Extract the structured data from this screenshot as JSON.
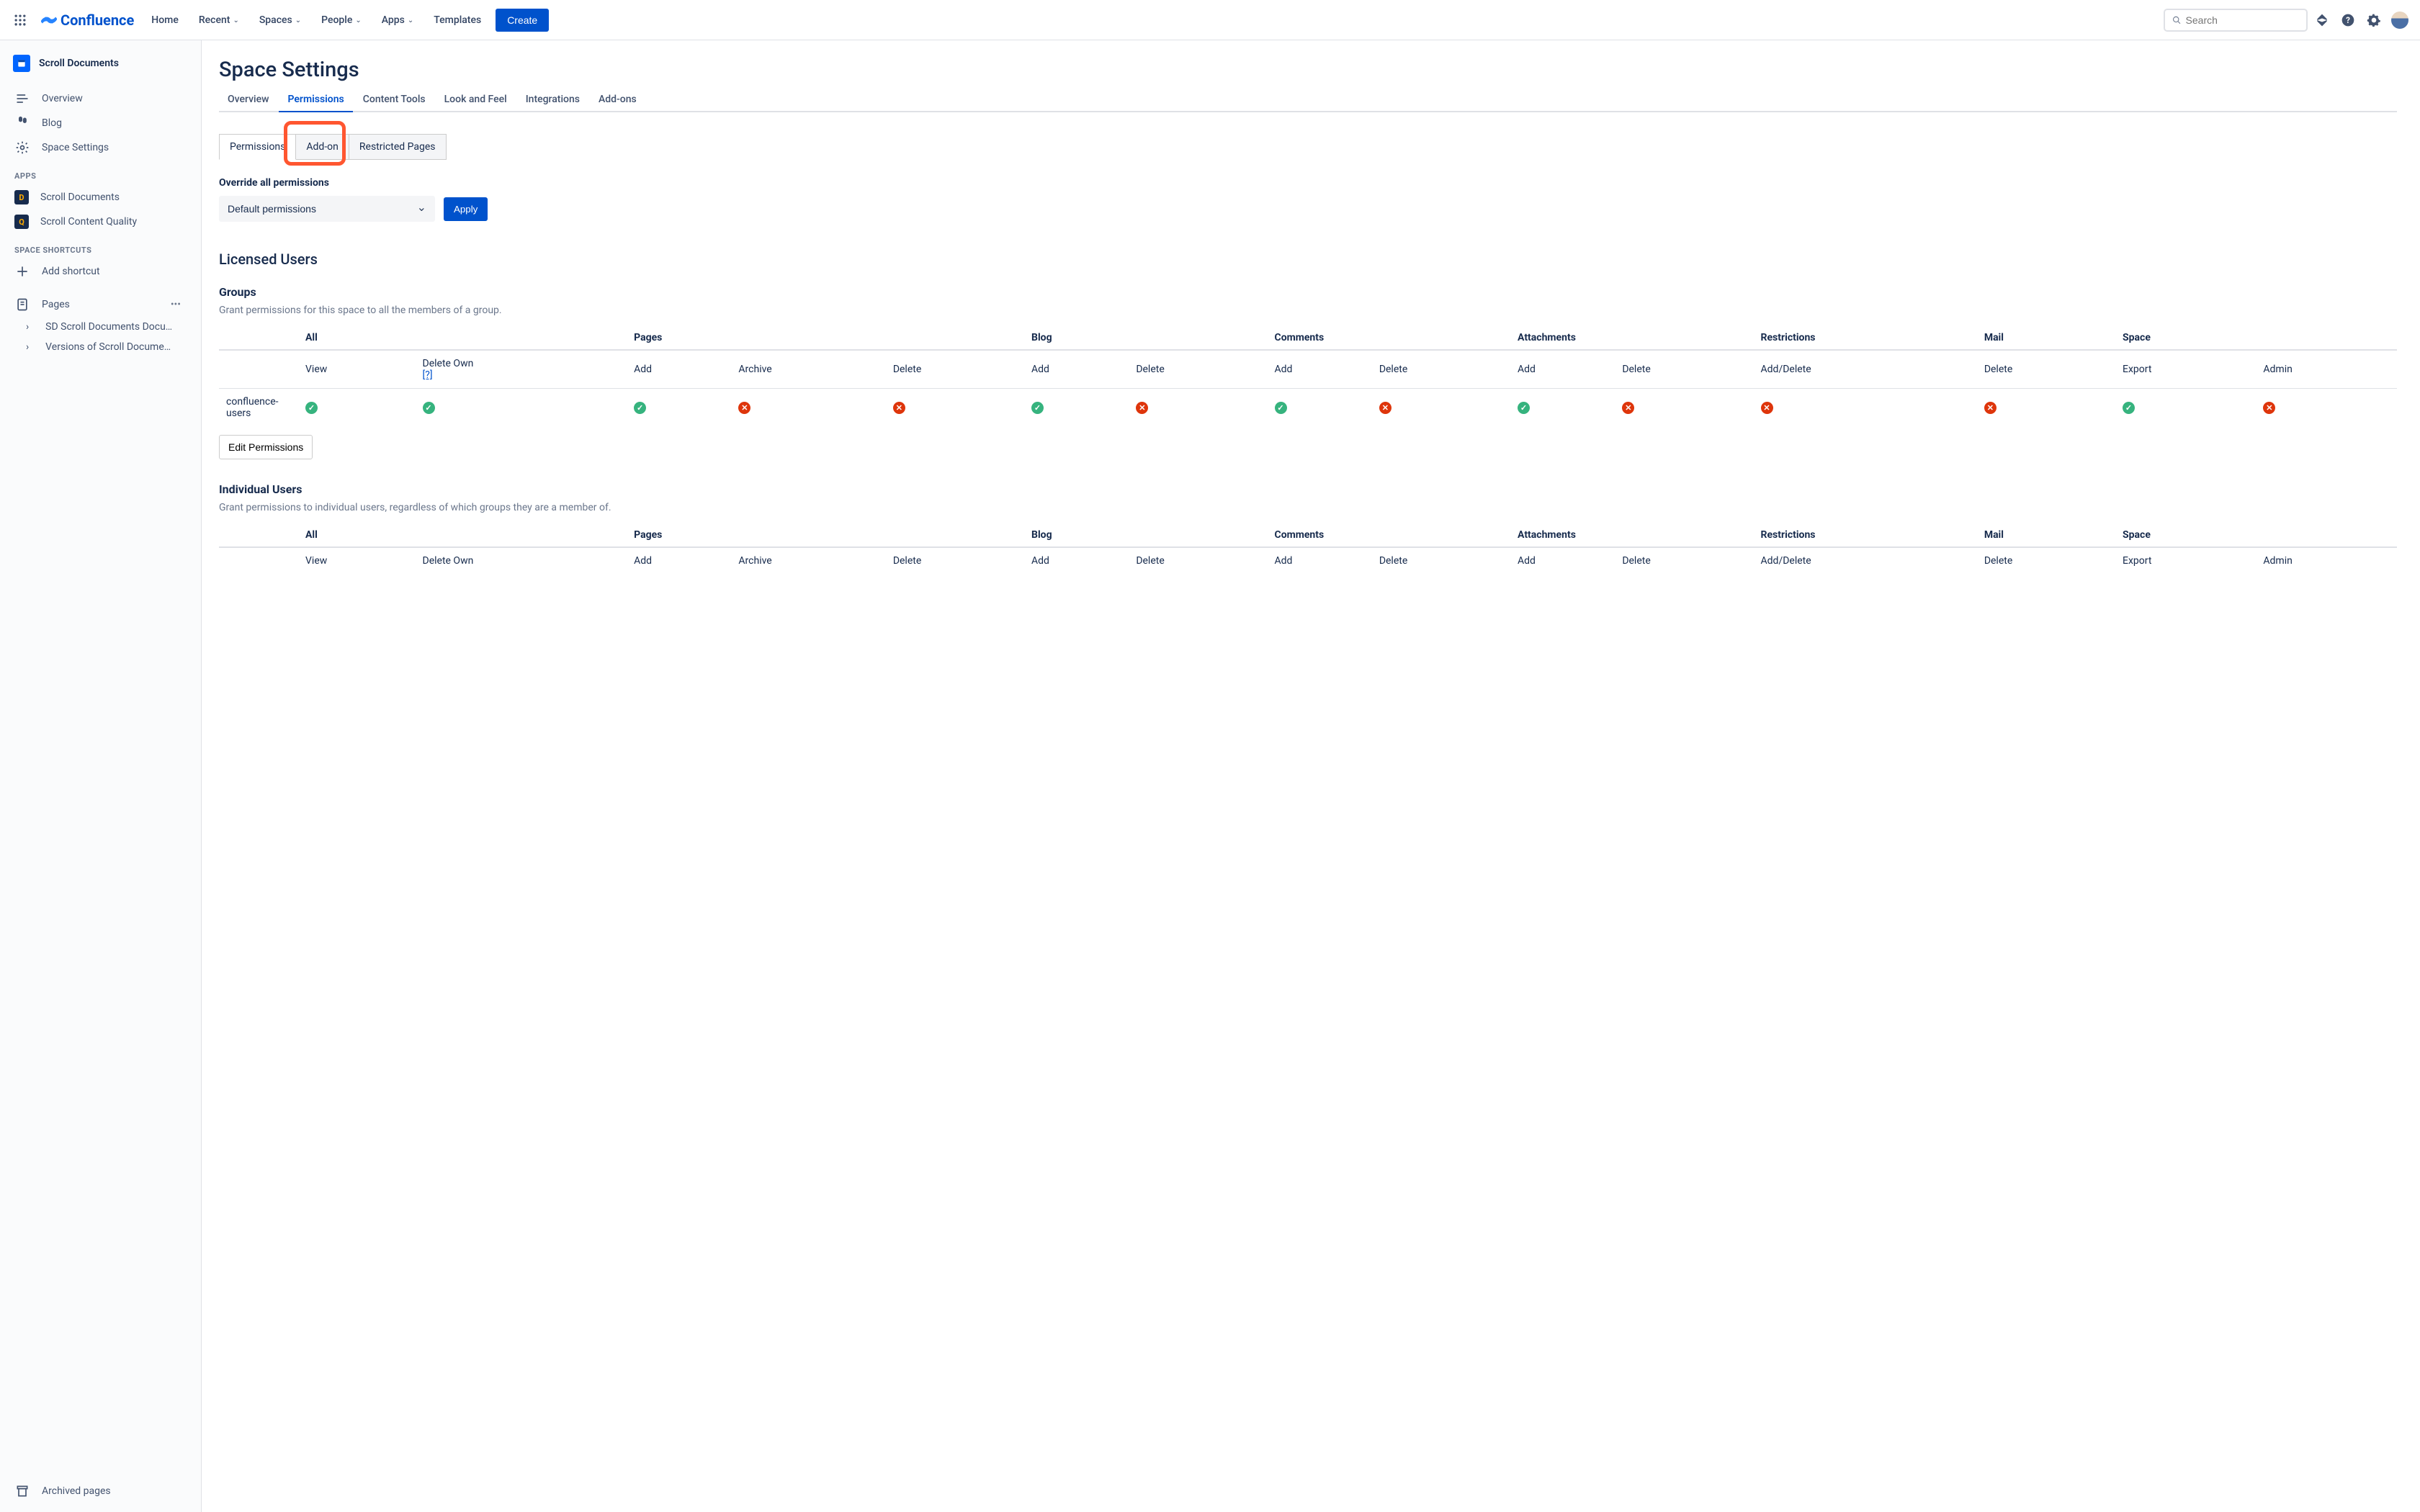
{
  "topnav": {
    "logo": "Confluence",
    "items": [
      "Home",
      "Recent",
      "Spaces",
      "People",
      "Apps",
      "Templates"
    ],
    "create": "Create",
    "search_placeholder": "Search"
  },
  "sidebar": {
    "space": "Scroll Documents",
    "nav": [
      {
        "label": "Overview"
      },
      {
        "label": "Blog"
      },
      {
        "label": "Space Settings"
      }
    ],
    "apps_heading": "APPS",
    "apps": [
      {
        "label": "Scroll Documents"
      },
      {
        "label": "Scroll Content Quality"
      }
    ],
    "shortcuts_heading": "SPACE SHORTCUTS",
    "add_shortcut": "Add shortcut",
    "pages": "Pages",
    "tree": [
      "SD Scroll Documents Docu…",
      "Versions of Scroll Docume…"
    ],
    "archived": "Archived pages"
  },
  "page": {
    "title": "Space Settings",
    "tabs": [
      "Overview",
      "Permissions",
      "Content Tools",
      "Look and Feel",
      "Integrations",
      "Add-ons"
    ],
    "active_tab": "Permissions",
    "subtabs": [
      "Permissions",
      "Add-on",
      "Restricted Pages"
    ],
    "active_subtab": "Permissions",
    "highlighted_subtab": "Add-on",
    "override_heading": "Override all permissions",
    "select_value": "Default permissions",
    "apply": "Apply",
    "licensed_users": "Licensed Users",
    "groups_heading": "Groups",
    "groups_desc": "Grant permissions for this space to all the members of a group.",
    "individual_heading": "Individual Users",
    "individual_desc": "Grant permissions to individual users, regardless of which groups they are a member of.",
    "edit_btn": "Edit Permissions",
    "columns": [
      "All",
      "Pages",
      "Blog",
      "Comments",
      "Attachments",
      "Restrictions",
      "Mail",
      "Space"
    ],
    "subcolumns": {
      "All": [
        "View",
        "Delete Own"
      ],
      "Pages": [
        "Add",
        "Archive",
        "Delete"
      ],
      "Blog": [
        "Add",
        "Delete"
      ],
      "Comments": [
        "Add",
        "Delete"
      ],
      "Attachments": [
        "Add",
        "Delete"
      ],
      "Restrictions": [
        "Add/Delete"
      ],
      "Mail": [
        "Delete"
      ],
      "Space": [
        "Export",
        "Admin"
      ]
    },
    "help": "[?]",
    "group_row": {
      "name": "confluence-users",
      "perms": [
        true,
        true,
        true,
        false,
        false,
        true,
        false,
        true,
        false,
        true,
        false,
        false,
        false,
        true,
        false
      ]
    }
  }
}
